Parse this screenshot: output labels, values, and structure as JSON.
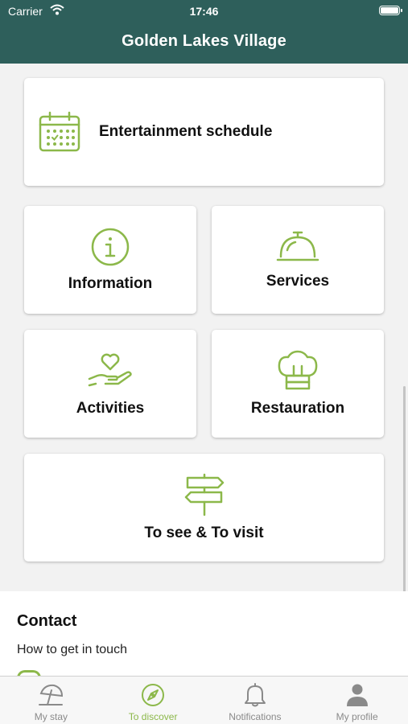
{
  "status_bar": {
    "carrier": "Carrier",
    "time": "17:46"
  },
  "header": {
    "title": "Golden Lakes Village"
  },
  "tiles": {
    "entertainment": {
      "label": "Entertainment schedule",
      "icon": "calendar-icon"
    },
    "information": {
      "label": "Information",
      "icon": "info-icon"
    },
    "services": {
      "label": "Services",
      "icon": "service-bell-icon"
    },
    "activities": {
      "label": "Activities",
      "icon": "hand-heart-icon"
    },
    "restauration": {
      "label": "Restauration",
      "icon": "chef-hat-icon"
    },
    "to_see": {
      "label": "To see & To visit",
      "icon": "signpost-icon"
    }
  },
  "contact": {
    "title": "Contact",
    "subtitle": "How to get in touch"
  },
  "tabbar": {
    "items": [
      {
        "label": "My stay",
        "icon": "beach-umbrella-icon",
        "active": false
      },
      {
        "label": "To discover",
        "icon": "compass-icon",
        "active": true
      },
      {
        "label": "Notifications",
        "icon": "bell-icon",
        "active": false
      },
      {
        "label": "My profile",
        "icon": "person-icon",
        "active": false
      }
    ]
  },
  "colors": {
    "header": "#2e5f5b",
    "accent": "#8cb84a",
    "inactive": "#8a8a8a"
  }
}
